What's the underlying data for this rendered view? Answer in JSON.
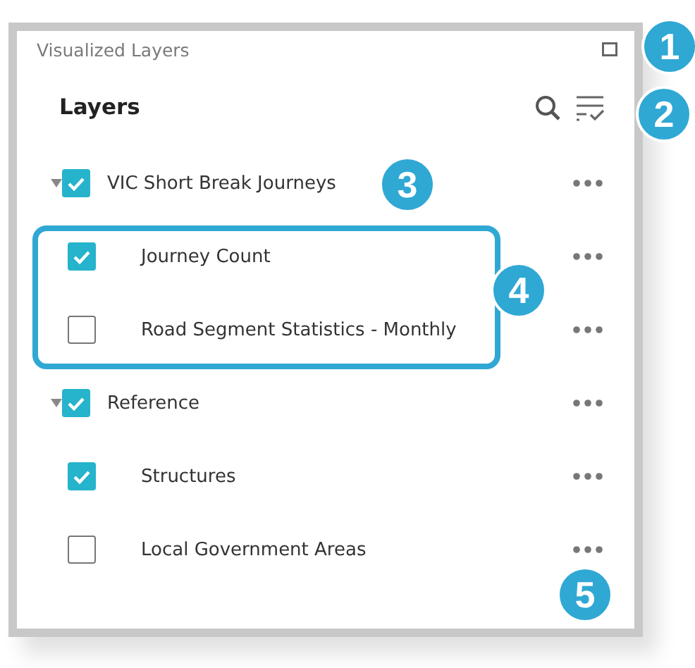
{
  "panel": {
    "title": "Visualized Layers"
  },
  "header": {
    "title": "Layers"
  },
  "layers": [
    {
      "label": "VIC Short Break Journeys",
      "checked": true,
      "expanded": true,
      "children_highlighted": true,
      "children": [
        {
          "label": "Journey Count",
          "checked": true
        },
        {
          "label": "Road Segment Statistics - Monthly",
          "checked": false
        }
      ]
    },
    {
      "label": "Reference",
      "checked": true,
      "expanded": true,
      "children": [
        {
          "label": "Structures",
          "checked": true
        },
        {
          "label": "Local Government Areas",
          "checked": false
        }
      ]
    }
  ],
  "callouts": [
    "1",
    "2",
    "3",
    "4",
    "5"
  ]
}
